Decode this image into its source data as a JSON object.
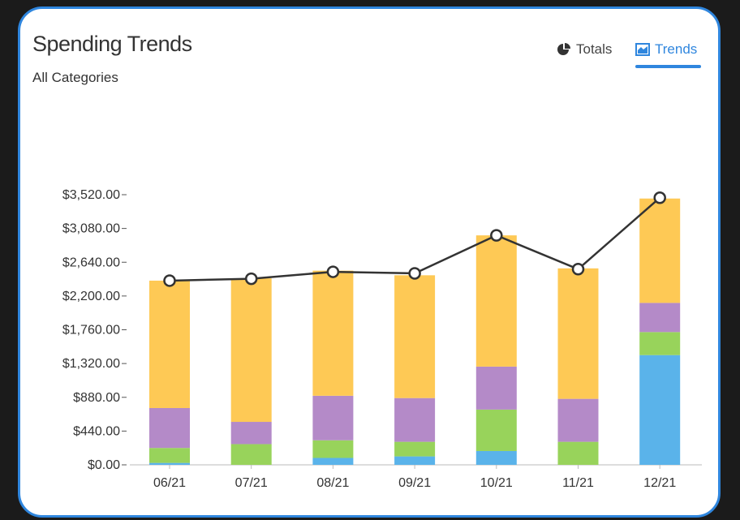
{
  "header": {
    "title": "Spending Trends",
    "subtitle": "All Categories"
  },
  "tabs": [
    {
      "label": "Totals",
      "icon": "pie-chart-icon",
      "active": false
    },
    {
      "label": "Trends",
      "icon": "area-chart-icon",
      "active": true
    }
  ],
  "colors": {
    "accent": "#2f86de",
    "blue": "#5ab3ea",
    "green": "#98d35b",
    "purple": "#b48ac8",
    "yellow": "#fec955",
    "line": "#333333"
  },
  "chart_data": {
    "type": "bar",
    "stacked": true,
    "categories": [
      "06/21",
      "07/21",
      "08/21",
      "09/21",
      "10/21",
      "11/21",
      "12/21"
    ],
    "y_ticks": [
      "$0.00",
      "$440.00",
      "$880.00",
      "$1,320.00",
      "$1,760.00",
      "$2,200.00",
      "$2,640.00",
      "$3,080.00",
      "$3,520.00"
    ],
    "ylim": [
      0,
      3520
    ],
    "series": [
      {
        "color": "#5ab3ea",
        "values": [
          25,
          0,
          90,
          110,
          180,
          0,
          1430
        ]
      },
      {
        "color": "#98d35b",
        "values": [
          195,
          270,
          230,
          190,
          540,
          300,
          300
        ]
      },
      {
        "color": "#b48ac8",
        "values": [
          520,
          290,
          580,
          570,
          560,
          560,
          380
        ]
      },
      {
        "color": "#fec955",
        "values": [
          1660,
          1870,
          1630,
          1600,
          1710,
          1700,
          1360
        ]
      }
    ],
    "line": {
      "values": [
        2400,
        2425,
        2515,
        2495,
        2990,
        2550,
        3480
      ]
    },
    "grid": false,
    "legend": "none",
    "xlabel": "",
    "ylabel": ""
  }
}
